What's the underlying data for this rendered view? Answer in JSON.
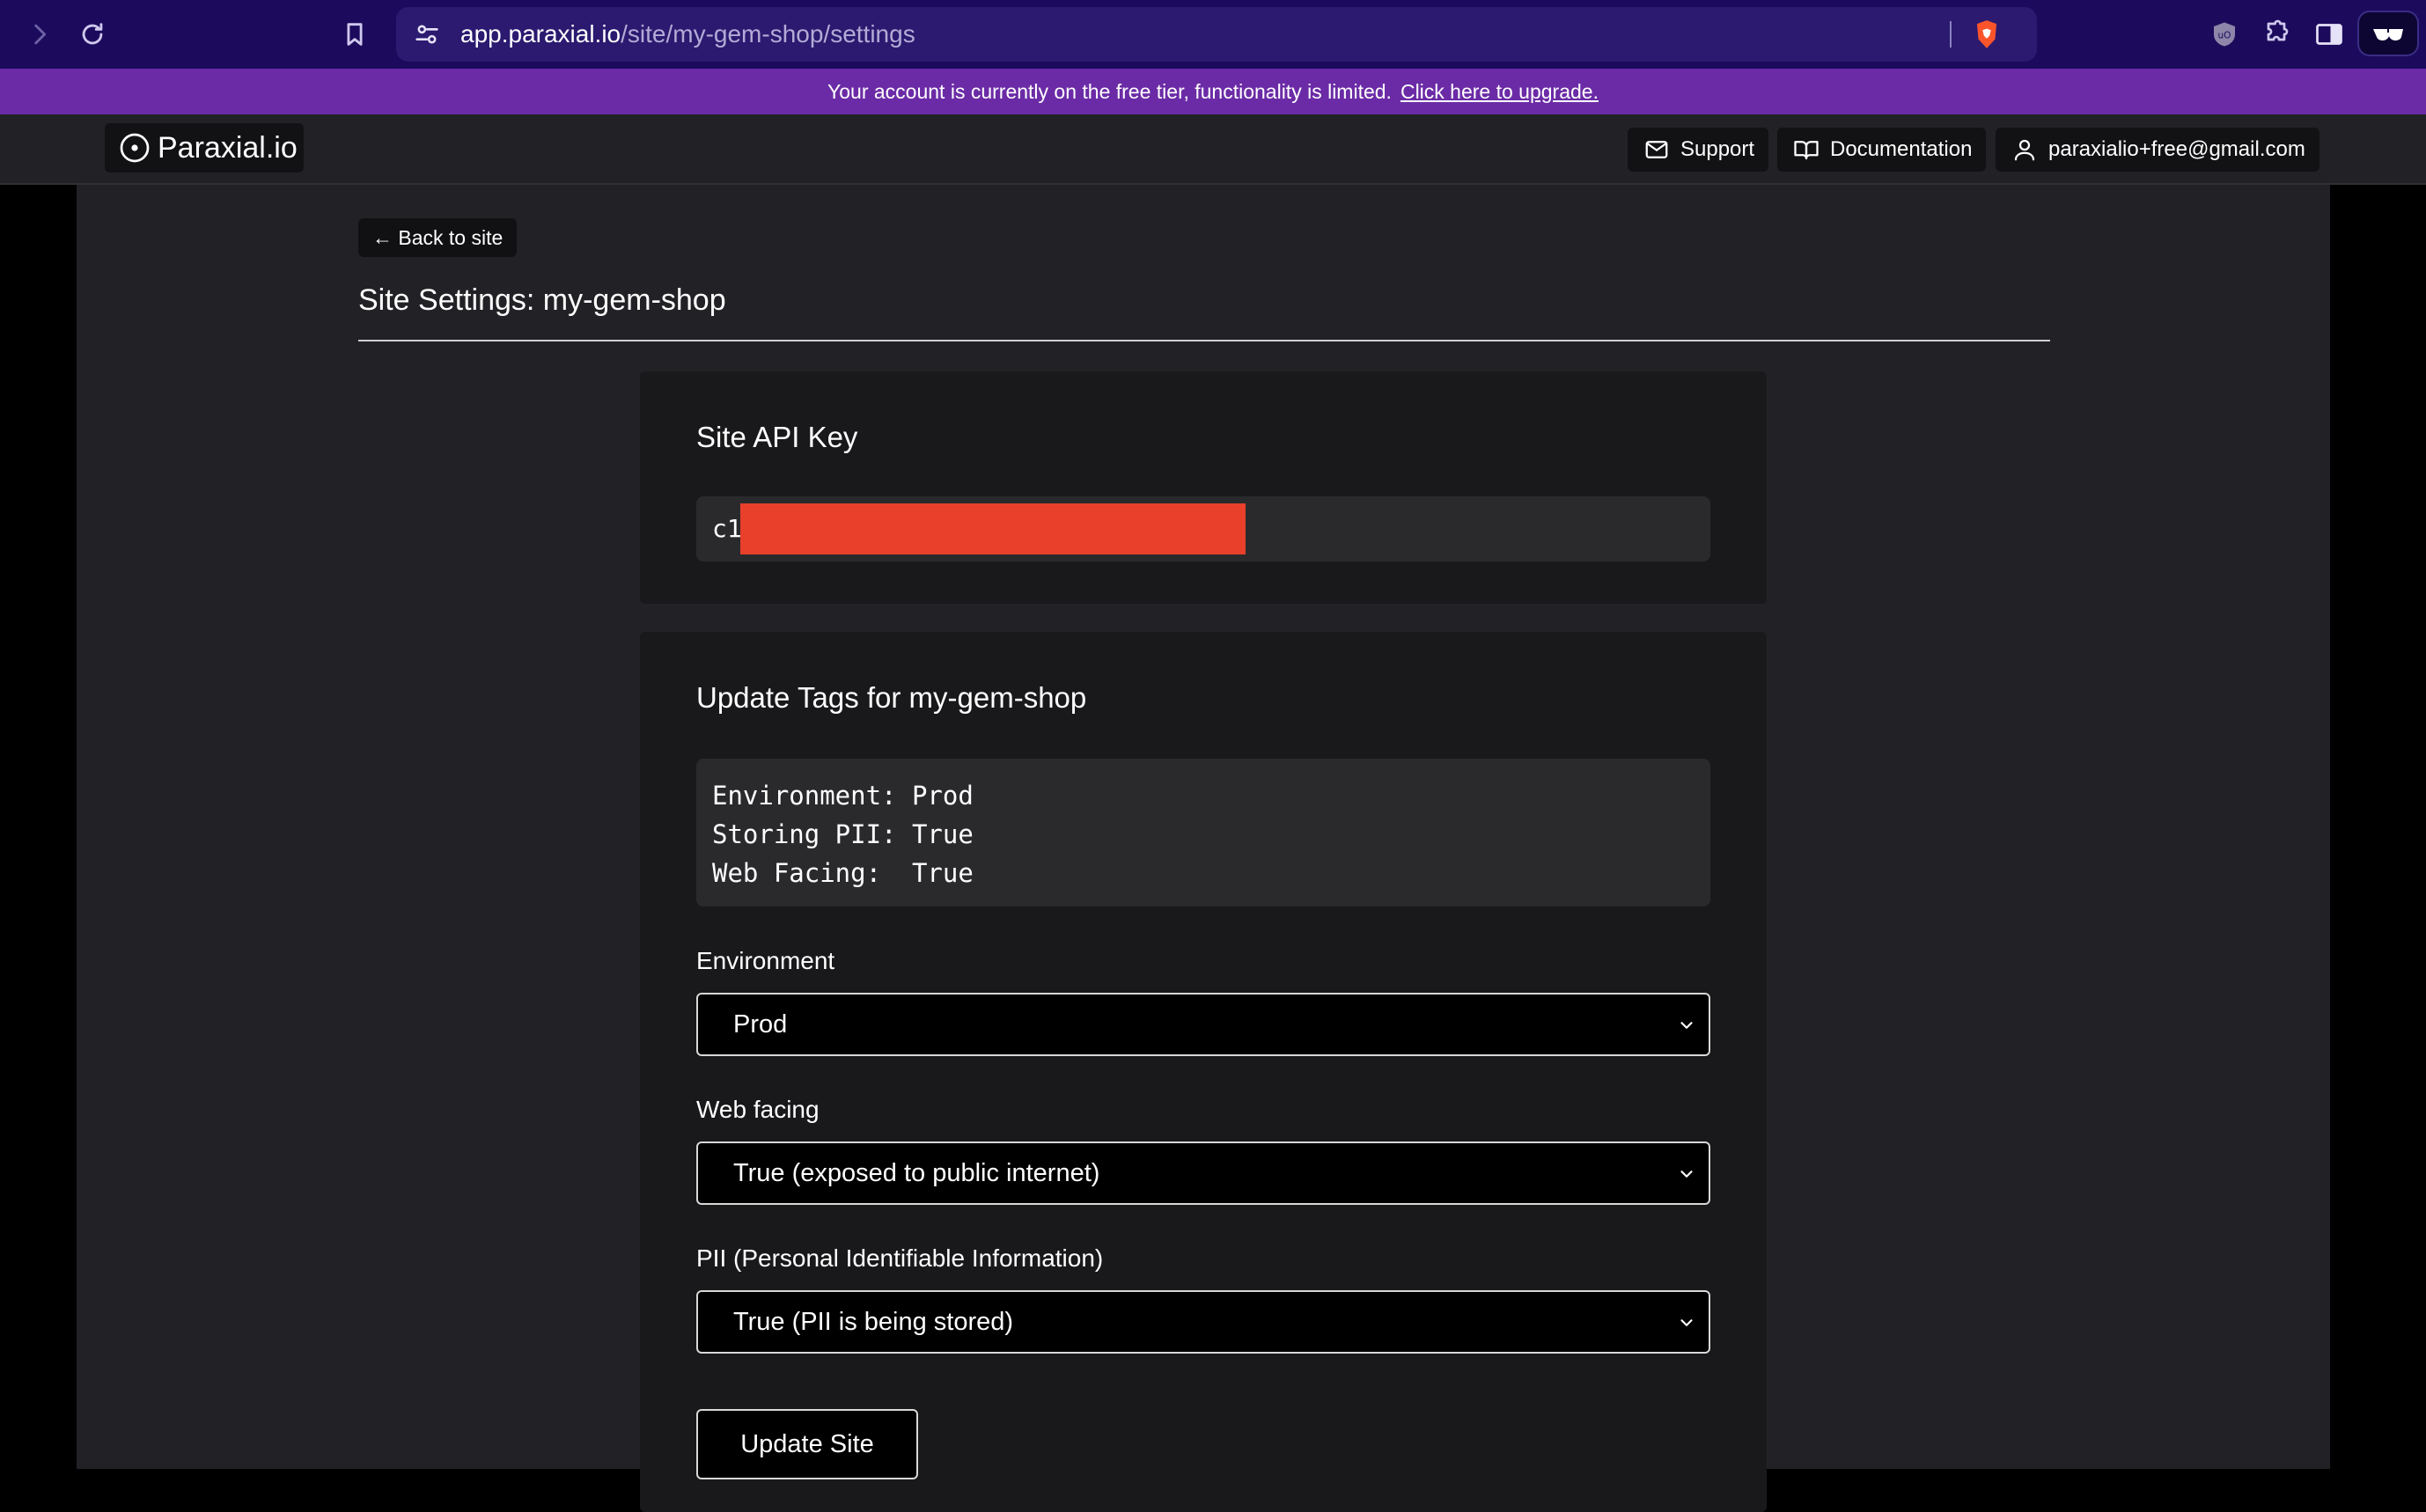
{
  "browser": {
    "url_host": "app.paraxial.io",
    "url_path": "/site/my-gem-shop/settings"
  },
  "banner": {
    "message": "Your account is currently on the free tier, functionality is limited.",
    "upgrade_link": "Click here to upgrade."
  },
  "header": {
    "logo_text": "Paraxial.io",
    "support_label": "Support",
    "docs_label": "Documentation",
    "user_email": "paraxialio+free@gmail.com"
  },
  "page": {
    "back_label": "← Back to site",
    "title": "Site Settings: my-gem-shop"
  },
  "api_key": {
    "title": "Site API Key",
    "prefix": "c1"
  },
  "tags": {
    "title": "Update Tags for my-gem-shop",
    "summary_lines": [
      "Environment: Prod",
      "Storing PII: True",
      "Web Facing:  True"
    ],
    "environment_label": "Environment",
    "environment_value": "Prod",
    "web_facing_label": "Web facing",
    "web_facing_value": "True (exposed to public internet)",
    "pii_label": "PII (Personal Identifiable Information)",
    "pii_value": "True (PII is being stored)",
    "update_button": "Update Site"
  },
  "colors": {
    "browser_bar": "#1c0b5c",
    "banner": "#6b2ba6",
    "redaction": "#e8402a",
    "card_bg": "#19191b",
    "page_bg": "#222226"
  }
}
